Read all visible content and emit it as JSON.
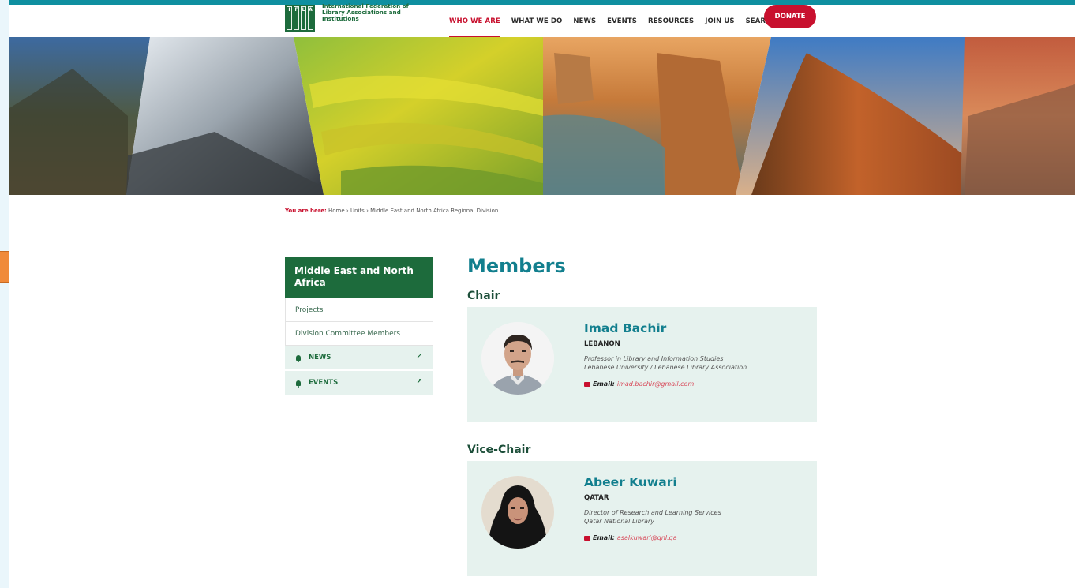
{
  "header": {
    "logo_letters": [
      "I",
      "F",
      "L",
      "A"
    ],
    "logo_text": "International Federation of Library Associations and Institutions",
    "nav": [
      "WHO WE ARE",
      "WHAT WE DO",
      "NEWS",
      "EVENTS",
      "RESOURCES",
      "JOIN US",
      "SEARCH"
    ],
    "active_nav": "WHO WE ARE",
    "donate_label": "DONATE"
  },
  "breadcrumb": {
    "lead": "You are here:",
    "items": [
      "Home",
      "Units",
      "Middle East and North Africa Regional Division"
    ],
    "separator": "›"
  },
  "sidebar": {
    "title": "Middle East and North Africa",
    "links": [
      "Projects",
      "Division Committee Members"
    ],
    "external": [
      "NEWS",
      "EVENTS"
    ],
    "external_arrow": "↗"
  },
  "main": {
    "title": "Members",
    "sections": [
      {
        "role": "Chair",
        "name": "Imad Bachir",
        "country": "LEBANON",
        "desc_line1": "Professor in Library and Information Studies",
        "desc_line2": "Lebanese University / Lebanese Library Association",
        "email_label": "Email:",
        "email": "imad.bachir@gmail.com"
      },
      {
        "role": "Vice-Chair",
        "name": "Abeer Kuwari",
        "country": "QATAR",
        "desc_line1": "Director of Research and Learning Services",
        "desc_line2": "Qatar National Library",
        "email_label": "Email:",
        "email": "asalkuwari@qnl.qa"
      }
    ]
  },
  "colors": {
    "accent_red": "#c8102e",
    "brand_green": "#1d6b3c",
    "teal": "#127f8e",
    "card_bg": "#e6f2ee"
  },
  "icons": [
    "search-icon",
    "bell-icon",
    "external-arrow-icon",
    "envelope-icon"
  ]
}
